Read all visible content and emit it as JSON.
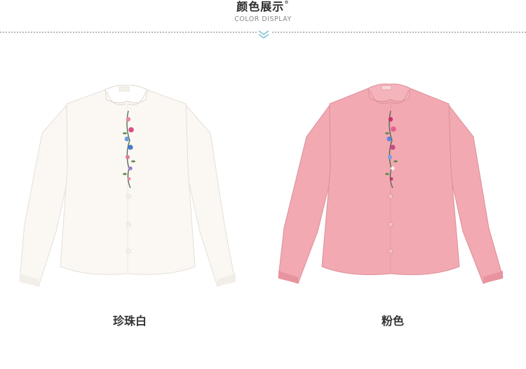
{
  "header": {
    "title": "颜色展示",
    "title_mark": "°",
    "subtitle": "COLOR DISPLAY",
    "divider_icon": "double-chevron-down-icon"
  },
  "products": [
    {
      "label": "珍珠白",
      "shirt_color": "#fbf8f3",
      "shadow_color": "#e8e3dc"
    },
    {
      "label": "粉色",
      "shirt_color": "#f2a9b2",
      "shadow_color": "#dc8f99"
    }
  ]
}
